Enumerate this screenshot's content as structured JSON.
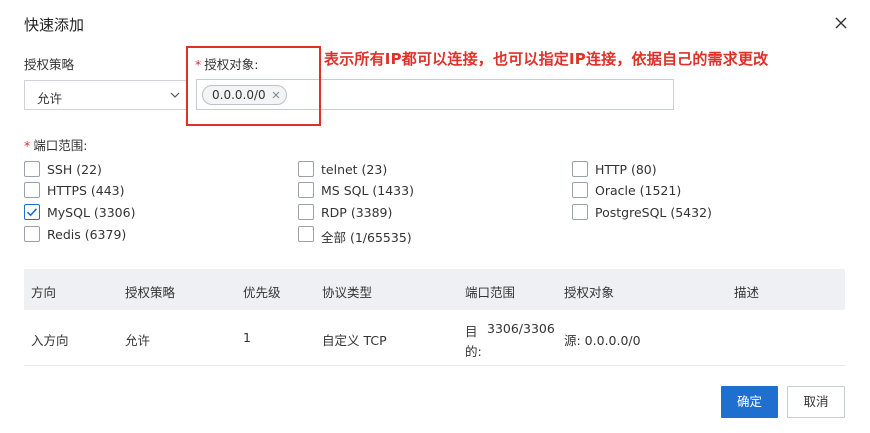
{
  "dialog": {
    "title": "快速添加"
  },
  "form": {
    "policy_label": "授权策略",
    "policy_value": "允许",
    "target_label": "授权对象:",
    "target_tag": "0.0.0.0/0",
    "port_label": "端口范围:",
    "required_mark": "*"
  },
  "annotation": {
    "text": "表示所有IP都可以连接，也可以指定IP连接，依据自己的需求更改",
    "color": "#e0302a"
  },
  "ports": [
    {
      "label": "SSH (22)",
      "checked": false
    },
    {
      "label": "telnet (23)",
      "checked": false
    },
    {
      "label": "HTTP (80)",
      "checked": false
    },
    {
      "label": "HTTPS (443)",
      "checked": false
    },
    {
      "label": "MS SQL (1433)",
      "checked": false
    },
    {
      "label": "Oracle (1521)",
      "checked": false
    },
    {
      "label": "MySQL (3306)",
      "checked": true
    },
    {
      "label": "RDP (3389)",
      "checked": false
    },
    {
      "label": "PostgreSQL (5432)",
      "checked": false
    },
    {
      "label": "Redis (6379)",
      "checked": false
    },
    {
      "label": "全部 (1/65535)",
      "checked": false
    }
  ],
  "table": {
    "headers": [
      "方向",
      "授权策略",
      "优先级",
      "协议类型",
      "端口范围",
      "授权对象",
      "描述"
    ],
    "rows": [
      {
        "direction": "入方向",
        "policy": "允许",
        "priority": "1",
        "protocol": "自定义 TCP",
        "port_prefix": "目",
        "port_range": "3306/3306",
        "port_suffix": "的:",
        "target": "源: 0.0.0.0/0",
        "description": ""
      }
    ]
  },
  "buttons": {
    "confirm": "确定",
    "cancel": "取消"
  },
  "colors": {
    "primary": "#1f6fd1",
    "required": "#e0302a",
    "table_header_bg": "#eef0f3"
  }
}
